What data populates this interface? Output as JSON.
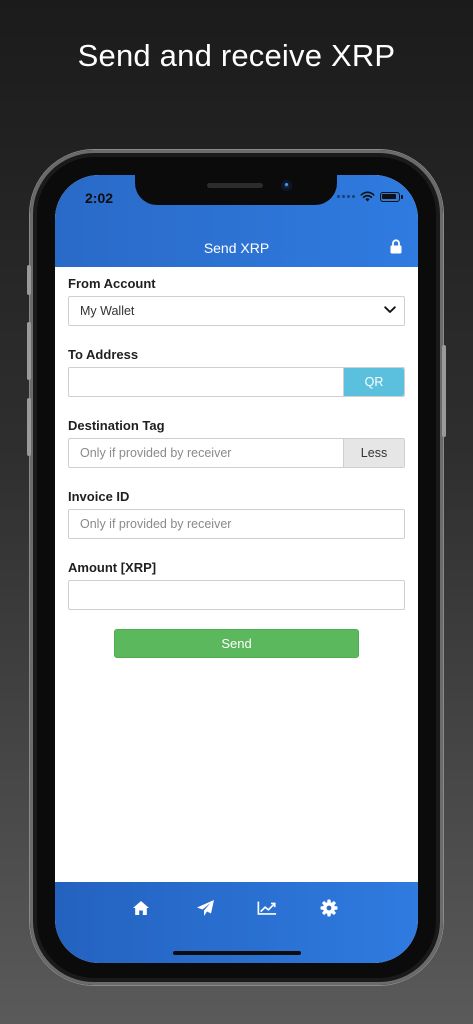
{
  "promo": {
    "headline": "Send and receive XRP"
  },
  "status_bar": {
    "time": "2:02",
    "icons": [
      "cellular-dots-icon",
      "wifi-icon",
      "battery-icon"
    ]
  },
  "nav": {
    "title": "Send XRP",
    "lock_icon": "lock-icon"
  },
  "form": {
    "from_account": {
      "label": "From Account",
      "value": "My Wallet",
      "chevron_icon": "chevron-down-icon"
    },
    "to_address": {
      "label": "To Address",
      "value": "",
      "addon": "QR"
    },
    "destination_tag": {
      "label": "Destination Tag",
      "placeholder": "Only if provided by receiver",
      "addon": "Less"
    },
    "invoice_id": {
      "label": "Invoice ID",
      "placeholder": "Only if provided by receiver"
    },
    "amount": {
      "label": "Amount [XRP]",
      "value": ""
    },
    "send_label": "Send"
  },
  "tabbar": {
    "items": [
      "home-icon",
      "send-icon",
      "chart-icon",
      "gear-icon"
    ]
  },
  "colors": {
    "accent_blue": "#2f7be0",
    "qr_button": "#5bc0de",
    "send_button": "#5cb85c",
    "less_button": "#e6e6e6"
  }
}
